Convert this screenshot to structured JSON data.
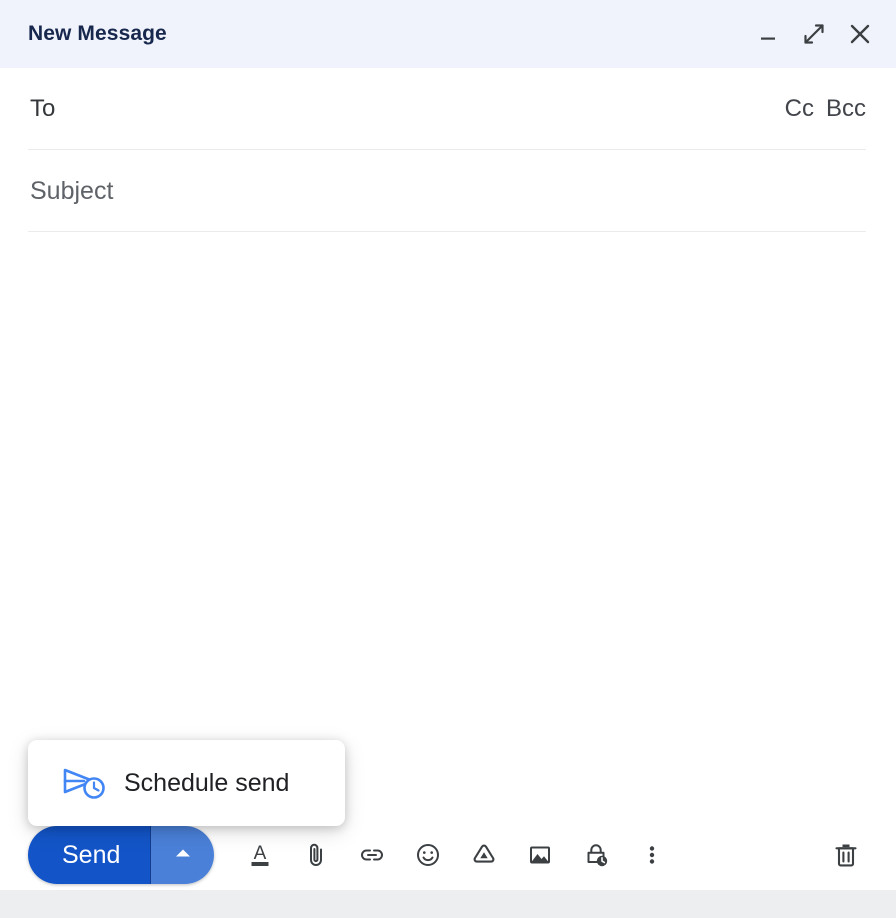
{
  "window": {
    "title": "New Message",
    "header_bg": "#f0f3fb",
    "title_color": "#17274d",
    "controls": [
      {
        "name": "minimize",
        "label": "Minimize"
      },
      {
        "name": "expand",
        "label": "Full screen"
      },
      {
        "name": "close",
        "label": "Save & close"
      }
    ]
  },
  "fields": {
    "to": {
      "label": "To",
      "value": "",
      "placeholder": "To"
    },
    "cc": {
      "label": "Cc"
    },
    "bcc": {
      "label": "Bcc"
    },
    "subject": {
      "label": "Subject",
      "value": "",
      "placeholder": "Subject"
    },
    "body": {
      "value": "",
      "placeholder": ""
    }
  },
  "popup": {
    "visible": true,
    "items": [
      {
        "label": "Schedule send",
        "icon": "schedule-send-icon",
        "icon_color": "#4285f4"
      }
    ]
  },
  "toolbar": {
    "send_label": "Send",
    "send_bg": "#1355c8",
    "send_arrow_bg": "#4a80d8",
    "send_text_color": "#ffffff",
    "icon_color": "#3c4043",
    "items": [
      {
        "name": "formatting-options-icon",
        "label": "Formatting options"
      },
      {
        "name": "attach-file-icon",
        "label": "Attach files"
      },
      {
        "name": "insert-link-icon",
        "label": "Insert link"
      },
      {
        "name": "insert-emoji-icon",
        "label": "Insert emoji"
      },
      {
        "name": "insert-drive-icon",
        "label": "Insert files using Drive"
      },
      {
        "name": "insert-photo-icon",
        "label": "Insert photo"
      },
      {
        "name": "confidential-mode-icon",
        "label": "Toggle confidential mode"
      },
      {
        "name": "more-options-icon",
        "label": "More options"
      }
    ],
    "discard_label": "Discard draft"
  },
  "footer": {
    "bg": "#eceef0"
  }
}
